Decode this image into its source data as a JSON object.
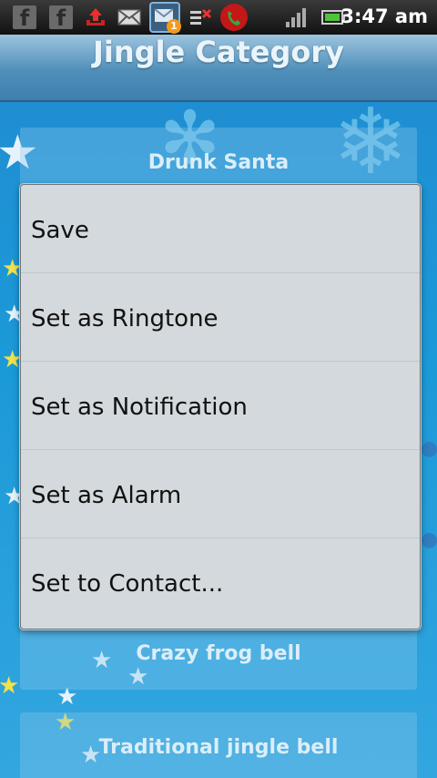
{
  "status_bar": {
    "time": "3:47 am",
    "icons": [
      "facebook-icon",
      "facebook-icon",
      "upload-icon",
      "gmail-icon",
      "message-icon",
      "missed-call-icon",
      "call-icon",
      "signal-icon",
      "battery-icon"
    ],
    "badge_count": "1"
  },
  "header": {
    "title": "Jingle Category"
  },
  "list": {
    "items": [
      {
        "label": "Drunk Santa"
      },
      {
        "label": "Crazy frog bell"
      },
      {
        "label": "Traditional jingle bell"
      }
    ]
  },
  "dialog": {
    "items": [
      {
        "label": "Save"
      },
      {
        "label": "Set as Ringtone"
      },
      {
        "label": "Set as Notification"
      },
      {
        "label": "Set as Alarm"
      },
      {
        "label": "Set to Contact..."
      }
    ]
  },
  "colors": {
    "status_bar": "#1a1a1a",
    "header": "#5c97c0",
    "background": "#1e8fcf",
    "dialog": "#d3d9dc"
  }
}
